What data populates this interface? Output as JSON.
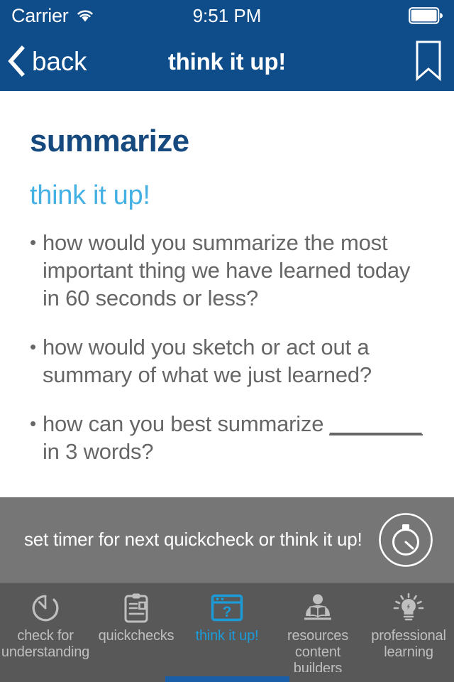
{
  "status_bar": {
    "carrier": "Carrier",
    "wifi_icon": "wifi-icon",
    "time": "9:51 PM",
    "battery_icon": "battery-full-icon"
  },
  "nav_bar": {
    "back_icon": "chevron-left-icon",
    "back_label": "back",
    "title": "think it up!",
    "bookmark_icon": "bookmark-icon"
  },
  "content": {
    "title": "summarize",
    "subtitle": "think it up!",
    "bullet_marker": "•",
    "bullets": [
      {
        "text": "how would you summarize the most important thing we have learned today in 60 seconds or less?"
      },
      {
        "text": "how would you sketch or act out a summary of what we just learned?"
      },
      {
        "text_before": "how can you best summarize ",
        "blank": "________",
        "text_after": " in 3 words?"
      }
    ]
  },
  "timer_bar": {
    "label": "set timer for next quickcheck or think it up!",
    "icon": "stopwatch-icon"
  },
  "tab_bar": {
    "tabs": [
      {
        "label": "check for\nunderstanding",
        "icon": "clock-gauge-icon",
        "active": false
      },
      {
        "label": "quickchecks",
        "icon": "clipboard-icon",
        "active": false
      },
      {
        "label": "think it up!",
        "icon": "browser-question-icon",
        "active": true
      },
      {
        "label": "resources\ncontent builders",
        "icon": "person-reading-icon",
        "active": false
      },
      {
        "label": "professional\nlearning",
        "icon": "lightbulb-icon",
        "active": false
      }
    ]
  },
  "colors": {
    "header_blue": "#0F4C8A",
    "title_navy": "#164A7E",
    "subtitle_sky": "#45B0E3",
    "body_gray": "#666666",
    "timer_bar_gray": "#767676",
    "tab_bar_gray": "#585858",
    "active_tab_blue": "#1B9BD8",
    "home_indicator_blue": "#1B5EA8"
  }
}
